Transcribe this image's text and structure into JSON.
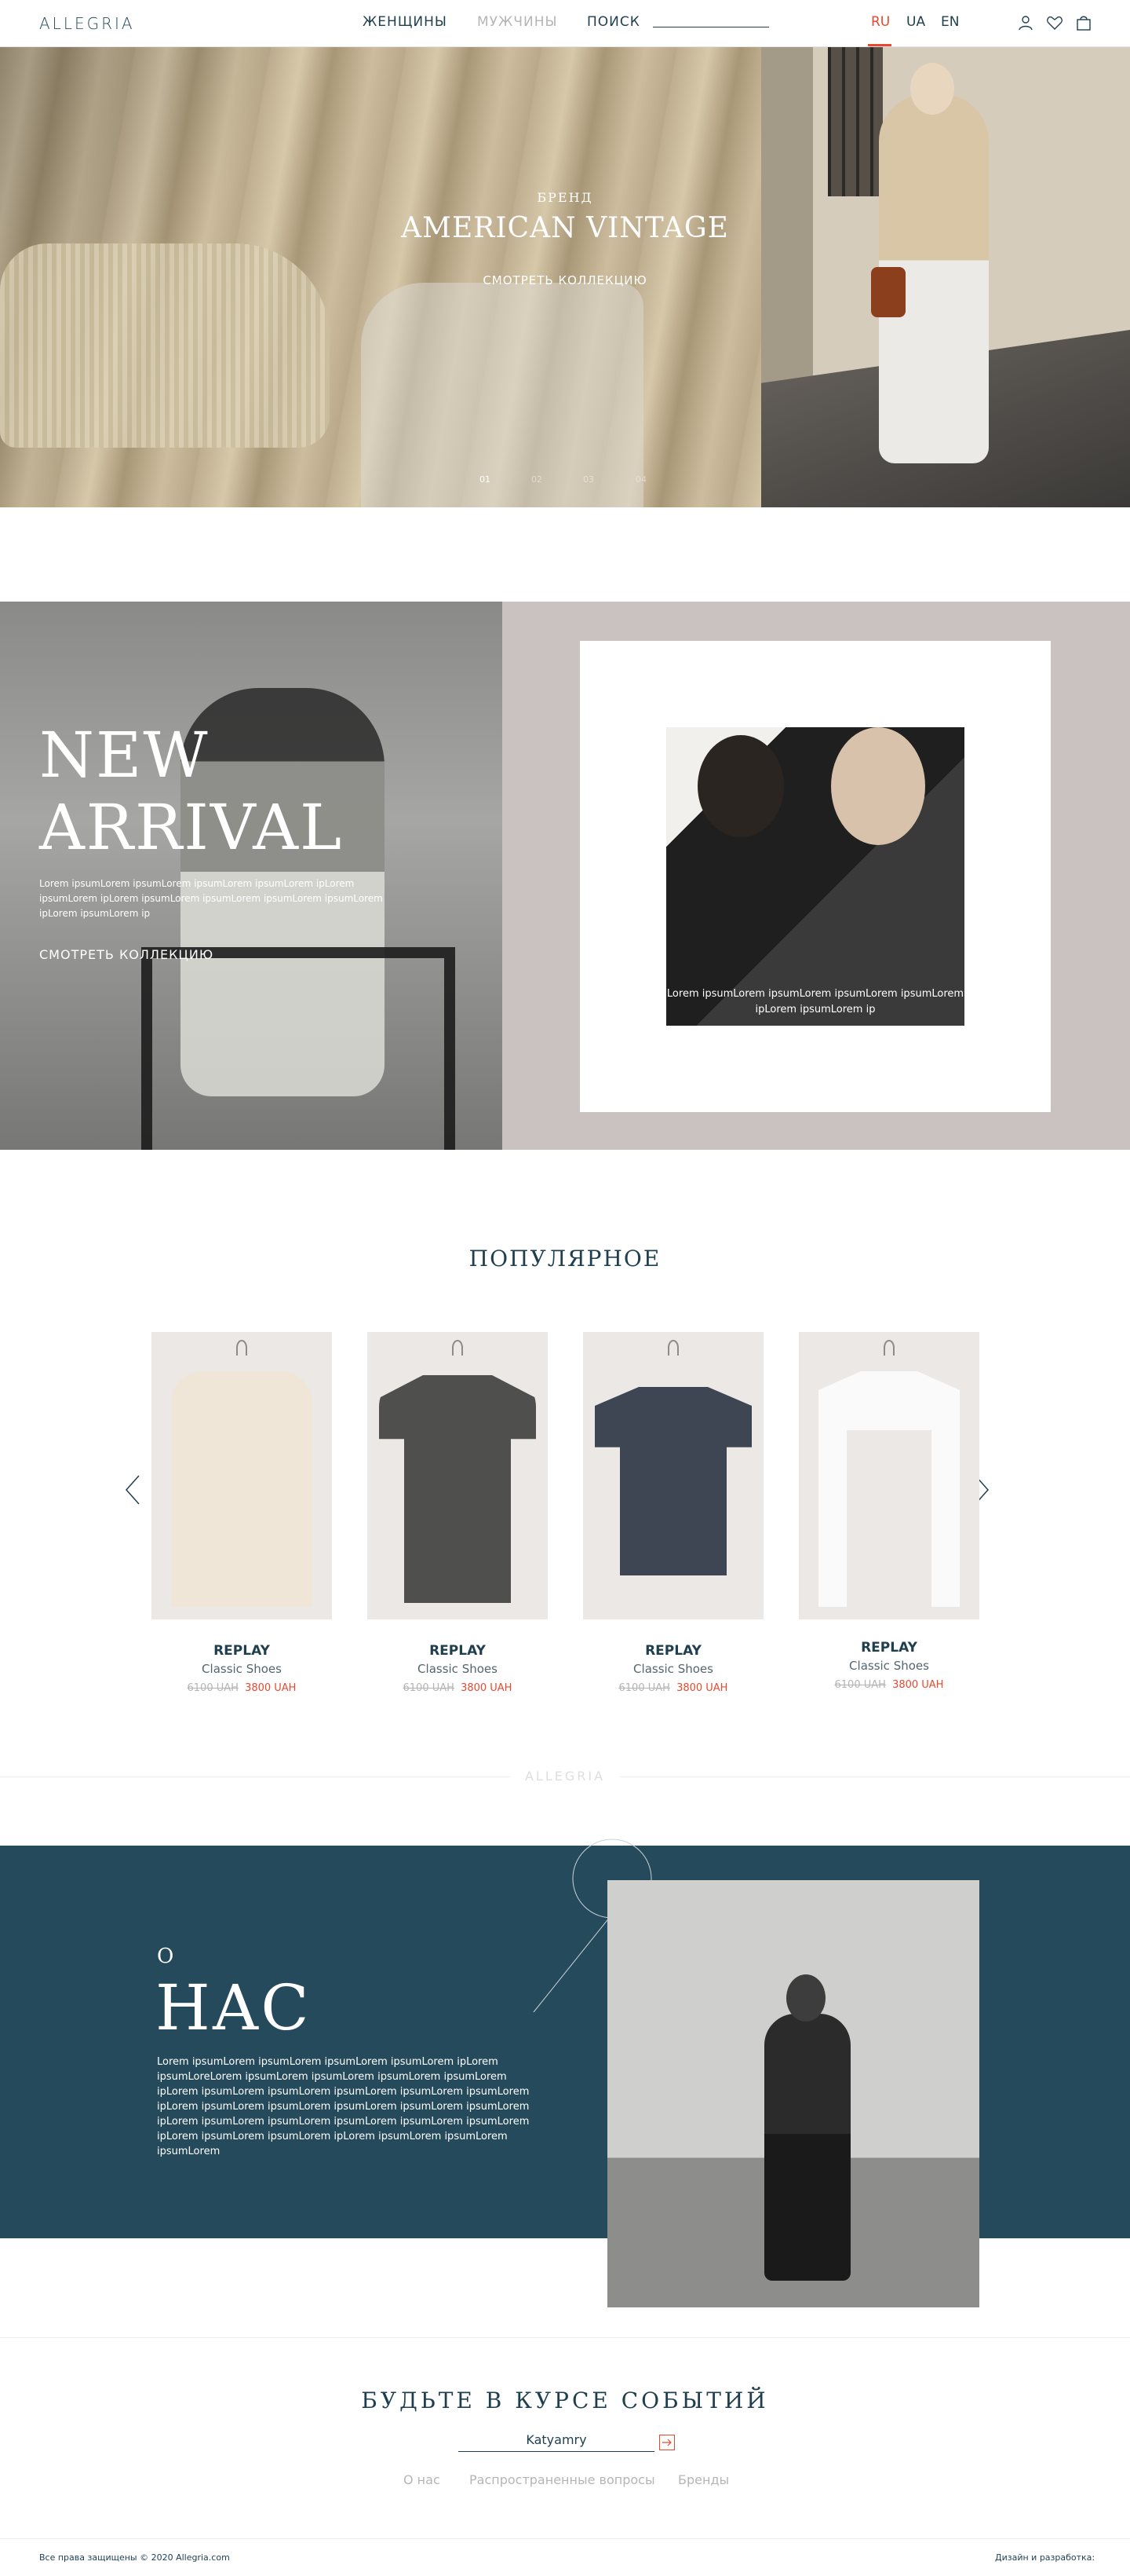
{
  "header": {
    "logo": "ALLEGRIA",
    "nav": {
      "women": "ЖЕНЩИНЫ",
      "men": "МУЖЧИНЫ",
      "search": "ПОИСК"
    },
    "languages": {
      "ru": "RU",
      "ua": "UA",
      "en": "EN",
      "active": "RU"
    },
    "icons": [
      "user-icon",
      "heart-icon",
      "bag-icon"
    ]
  },
  "hero": {
    "label": "БРЕНД",
    "title": "AMERICAN VINTAGE",
    "link": "СМОТРЕТЬ КОЛЛЕКЦИЮ",
    "slides": [
      "01",
      "02",
      "03",
      "04"
    ],
    "active_slide": "01"
  },
  "arrival": {
    "title_line1": "NEW",
    "title_line2": "ARRIVAL",
    "text": "Lorem ipsumLorem ipsumLorem ipsumLorem ipsumLorem ipLorem ipsumLorem ipLorem ipsumLorem ipsumLorem ipsumLorem ipsumLorem ipLorem ipsumLorem ip",
    "link": "СМОТРЕТЬ КОЛЛЕКЦИЮ",
    "card_text": "Lorem ipsumLorem ipsumLorem ipsumLorem ipsumLorem ipLorem ipsumLorem ip"
  },
  "popular": {
    "title": "ПОПУЛЯРНОЕ",
    "products": [
      {
        "brand": "REPLAY",
        "name": "Classic Shoes",
        "old_price": "6100 UAH",
        "price": "3800 UAH"
      },
      {
        "brand": "REPLAY",
        "name": "Classic Shoes",
        "old_price": "6100 UAH",
        "price": "3800 UAH"
      },
      {
        "brand": "REPLAY",
        "name": "Classic Shoes",
        "old_price": "6100 UAH",
        "price": "3800 UAH"
      },
      {
        "brand": "REPLAY",
        "name": "Classic Shoes",
        "old_price": "6100 UAH",
        "price": "3800 UAH"
      }
    ]
  },
  "divider_logo": "ALLEGRIA",
  "about": {
    "pre": "О",
    "title": "НАС",
    "text": "Lorem ipsumLorem ipsumLorem ipsumLorem ipsumLorem ipLorem ipsumLoreLorem ipsumLorem ipsumLorem ipsumLorem ipsumLorem ipLorem ipsumLorem ipsumLorem ipsumLorem ipsumLorem ipsumLorem ipLorem ipsumLorem ipsumLorem ipsumLorem ipsumLorem ipsumLorem ipLorem ipsumLorem ipsumLorem ipsumLorem ipsumLorem ipsumLorem ipLorem ipsumLorem ipsumLorem ipLorem ipsumLorem ipsumLorem ipsumLorem"
  },
  "newsletter": {
    "title": "БУДЬТЕ В КУРСЕ СОБЫТИЙ",
    "input_value": "Katyamry"
  },
  "footer": {
    "links": [
      "О нас",
      "Распространенные вопросы",
      "Бренды"
    ],
    "copyright": "Все права защищены © 2020 Allegria.com",
    "design": "Дизайн и разработка:"
  },
  "colors": {
    "accent": "#e8492e",
    "primary": "#244a5b",
    "muted": "#b5b5b5"
  }
}
